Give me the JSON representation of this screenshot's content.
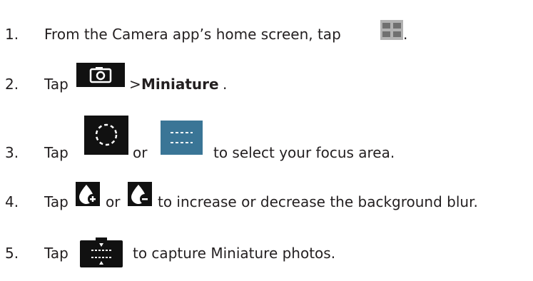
{
  "steps": [
    {
      "number": "1.",
      "text_before": "From the Camera app’s home screen, tap",
      "text_after": ".",
      "icon": "grid-menu-icon"
    },
    {
      "number": "2.",
      "text_before": "Tap",
      "separator": ">",
      "bold_text": "Miniature",
      "text_after": ".",
      "icon": "camera-mode-icon"
    },
    {
      "number": "3.",
      "text_before": "Tap",
      "or_text": "or",
      "text_after": "to select your focus area.",
      "icon_a": "circle-focus-icon",
      "icon_b": "band-focus-icon"
    },
    {
      "number": "4.",
      "text_before": "Tap",
      "or_text": "or",
      "text_after": "to increase or decrease the background blur.",
      "icon_a": "blur-increase-icon",
      "icon_b": "blur-decrease-icon"
    },
    {
      "number": "5.",
      "text_before": "Tap",
      "text_after": "to capture Miniature photos.",
      "icon": "shutter-icon"
    }
  ],
  "colors": {
    "text": "#231f20",
    "grid_icon_bg": "#b2b2b2",
    "icon_dark": "#111111",
    "band_icon_bg": "#3a7596"
  }
}
